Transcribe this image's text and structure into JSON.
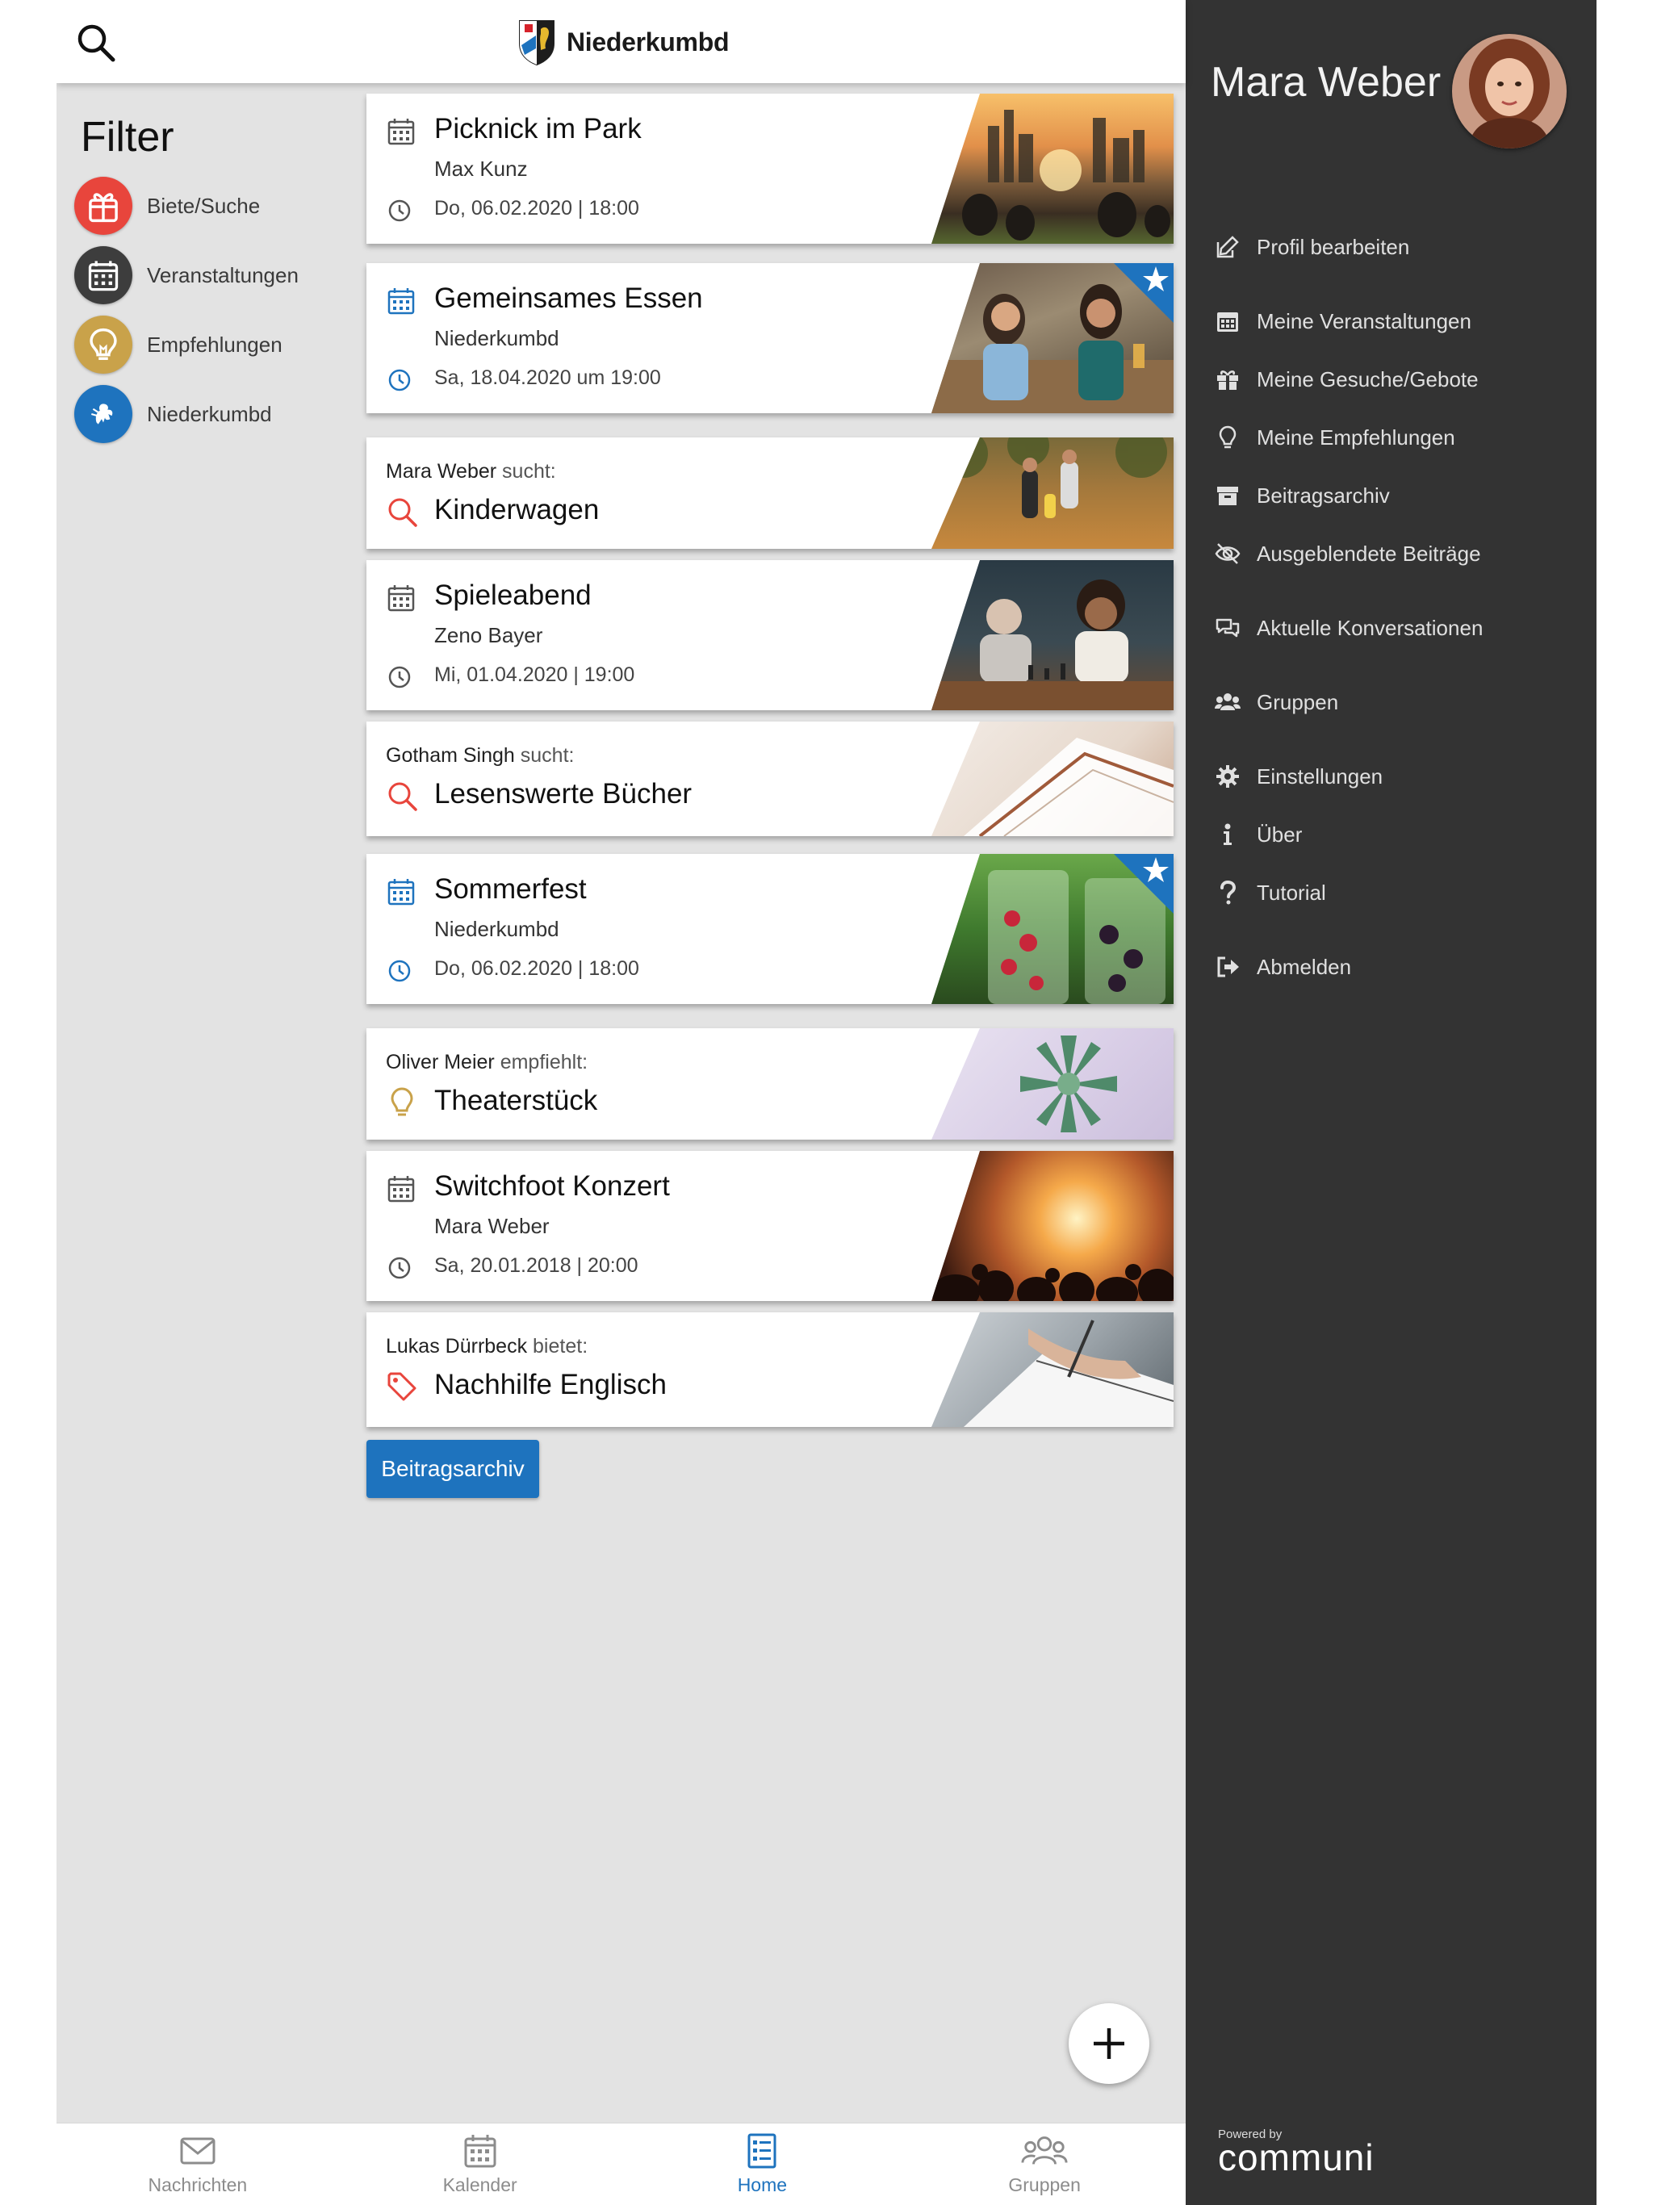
{
  "header": {
    "app_name": "Niederkumbd"
  },
  "filter": {
    "title": "Filter",
    "items": [
      {
        "label": "Biete/Suche",
        "color": "#e8453c",
        "icon": "gift-icon"
      },
      {
        "label": "Veranstaltungen",
        "color": "#3d3d3d",
        "icon": "calendar-icon"
      },
      {
        "label": "Empfehlungen",
        "color": "#c9a24a",
        "icon": "lightbulb-icon"
      },
      {
        "label": "Niederkumbd",
        "color": "#1e73be",
        "icon": "lion-crest-icon"
      }
    ]
  },
  "feed": [
    {
      "type": "event",
      "title": "Picknick im Park",
      "subtitle": "Max Kunz",
      "time": "Do, 06.02.2020 | 18:00",
      "icon_color": "#555555",
      "featured": false,
      "photo": "city-sunset-picnic"
    },
    {
      "type": "event",
      "title": "Gemeinsames Essen",
      "subtitle": "Niederkumbd",
      "time": "Sa, 18.04.2020 um 19:00",
      "icon_color": "#1e73be",
      "featured": true,
      "photo": "women-laughing"
    },
    {
      "type": "offer",
      "who": "Mara Weber",
      "verb": "sucht:",
      "title": "Kinderwagen",
      "icon": "search-icon",
      "icon_color": "#e8453c",
      "photo": "autumn-park-walk"
    },
    {
      "type": "event",
      "title": "Spieleabend",
      "subtitle": "Zeno Bayer",
      "time": "Mi, 01.04.2020 | 19:00",
      "icon_color": "#555555",
      "featured": false,
      "photo": "chess-game"
    },
    {
      "type": "offer",
      "who": "Gotham Singh",
      "verb": "sucht:",
      "title": "Lesenswerte Bücher",
      "icon": "search-icon",
      "icon_color": "#e8453c",
      "photo": "open-book"
    },
    {
      "type": "event",
      "title": "Sommerfest",
      "subtitle": "Niederkumbd",
      "time": "Do, 06.02.2020 | 18:00",
      "icon_color": "#1e73be",
      "featured": true,
      "photo": "berries-drink"
    },
    {
      "type": "offer",
      "who": "Oliver Meier",
      "verb": "empfiehlt:",
      "title": "Theaterstück",
      "icon": "lightbulb-icon",
      "icon_color": "#c9a24a",
      "photo": "succulent"
    },
    {
      "type": "event",
      "title": "Switchfoot Konzert",
      "subtitle": "Mara Weber",
      "time": "Sa, 20.01.2018 | 20:00",
      "icon_color": "#555555",
      "featured": false,
      "photo": "concert-crowd"
    },
    {
      "type": "offer",
      "who": "Lukas Dürrbeck",
      "verb": "bietet:",
      "title": "Nachhilfe Englisch",
      "icon": "tag-icon",
      "icon_color": "#e8453c",
      "photo": "writing-notebook"
    }
  ],
  "archive_button": "Beitragsarchiv",
  "bottom_nav": [
    {
      "label": "Nachrichten",
      "icon": "envelope-icon",
      "active": false
    },
    {
      "label": "Kalender",
      "icon": "calendar-icon",
      "active": false
    },
    {
      "label": "Home",
      "icon": "list-icon",
      "active": true
    },
    {
      "label": "Gruppen",
      "icon": "group-icon",
      "active": false
    }
  ],
  "drawer": {
    "user_name": "Mara Weber",
    "menu": [
      {
        "label": "Profil bearbeiten",
        "icon": "edit-icon"
      },
      {
        "label": "Meine Veranstaltungen",
        "icon": "calendar-icon"
      },
      {
        "label": "Meine Gesuche/Gebote",
        "icon": "gift-icon"
      },
      {
        "label": "Meine Empfehlungen",
        "icon": "lightbulb-icon"
      },
      {
        "label": "Beitragsarchiv",
        "icon": "archive-icon"
      },
      {
        "label": "Ausgeblendete Beiträge",
        "icon": "eye-slash-icon"
      },
      {
        "label": "Aktuelle Konversationen",
        "icon": "chat-icon"
      },
      {
        "label": "Gruppen",
        "icon": "users-icon"
      },
      {
        "label": "Einstellungen",
        "icon": "gear-icon"
      },
      {
        "label": "Über",
        "icon": "info-icon"
      },
      {
        "label": "Tutorial",
        "icon": "question-icon"
      },
      {
        "label": "Abmelden",
        "icon": "sign-out-icon"
      }
    ],
    "powered_by": "Powered by",
    "brand": "communi"
  },
  "colors": {
    "accent": "#1e73be",
    "drawer_bg": "#333333",
    "page_bg": "#e3e3e3"
  }
}
